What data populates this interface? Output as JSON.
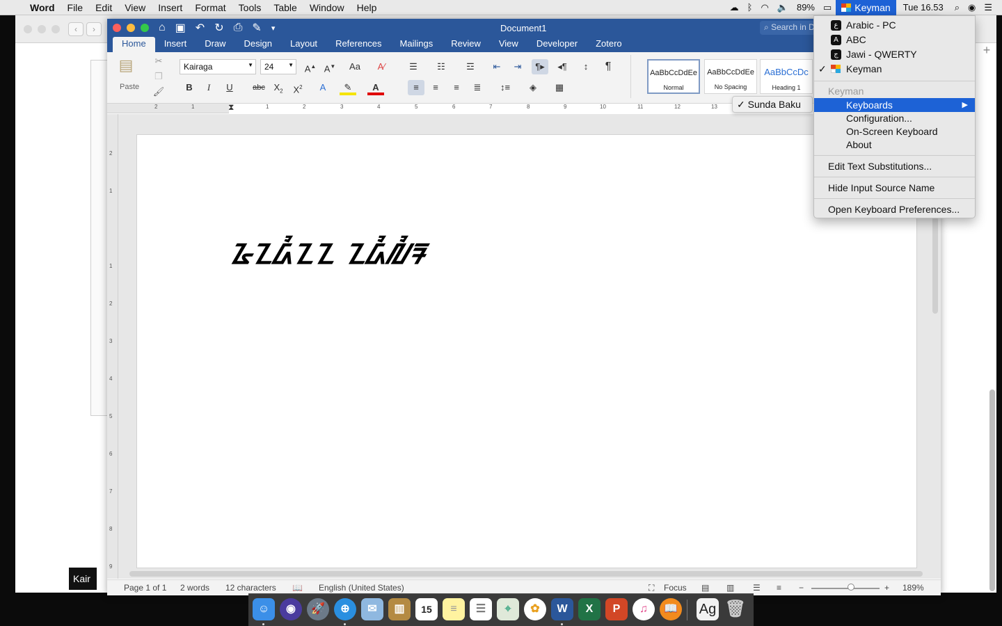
{
  "menubar": {
    "app_name": "Word",
    "menus": [
      "File",
      "Edit",
      "View",
      "Insert",
      "Format",
      "Tools",
      "Table",
      "Window",
      "Help"
    ],
    "battery": "89%",
    "input_source": "Keyman",
    "clock": "Tue 16.53"
  },
  "word": {
    "doc_title": "Document1",
    "search_placeholder": "Search in Document",
    "tabs": [
      "Home",
      "Insert",
      "Draw",
      "Design",
      "Layout",
      "References",
      "Mailings",
      "Review",
      "View",
      "Developer",
      "Zotero"
    ],
    "font_name": "Kairaga",
    "font_size": "24",
    "paste_label": "Paste",
    "styles": [
      {
        "preview": "AaBbCcDdEe",
        "name": "Normal"
      },
      {
        "preview": "AaBbCcDdEe",
        "name": "No Spacing"
      },
      {
        "preview": "AaBbCcDc",
        "name": "Heading 1"
      }
    ],
    "ruler_numbers": [
      "2",
      "1",
      "1",
      "2",
      "3",
      "4",
      "5",
      "6",
      "7",
      "8",
      "9",
      "10",
      "11",
      "12",
      "13"
    ],
    "vruler_numbers": [
      "2",
      "1",
      "1",
      "2",
      "3",
      "4",
      "5",
      "6",
      "7",
      "8",
      "9"
    ],
    "document_text": "ᮅᮔᮓᮤᮔᮔ ᮔᮓᮤᮜᮤᮛ",
    "status": {
      "page": "Page 1 of 1",
      "words": "2 words",
      "chars": "12 characters",
      "language": "English (United States)",
      "focus": "Focus",
      "zoom": "189%"
    }
  },
  "sunda_popup": {
    "check": "✓",
    "label": "Sunda Baku"
  },
  "input_menu": {
    "sources": [
      {
        "label": "Arabic - PC",
        "icon": "ع",
        "checked": false
      },
      {
        "label": "ABC",
        "icon": "A",
        "checked": false
      },
      {
        "label": "Jawi - QWERTY",
        "icon": "ج",
        "checked": false
      },
      {
        "label": "Keyman",
        "icon": "keyman-logo",
        "checked": true
      }
    ],
    "section_header": "Keyman",
    "keyman_items": [
      "Keyboards",
      "Configuration...",
      "On-Screen Keyboard",
      "About"
    ],
    "submenu_arrow": "▶",
    "edit_substitutions": "Edit Text Substitutions...",
    "hide_name": "Hide Input Source Name",
    "open_prefs": "Open Keyboard Preferences..."
  },
  "bg_window": {
    "dark_label": "Kair"
  },
  "dock": {
    "apps": [
      "Finder",
      "Siri",
      "Launchpad",
      "Safari",
      "Mail",
      "Notes",
      "Calendar",
      "Stickies",
      "Reminders",
      "Maps",
      "Photos",
      "Word",
      "Excel",
      "PowerPoint",
      "iTunes",
      "Books",
      "Font Book",
      "Trash"
    ],
    "calendar_day": "15",
    "fontbook_glyph": "Ag"
  },
  "colors": {
    "word_blue": "#2b579a",
    "menu_highlight": "#1d62d6",
    "dock": "#3a3a3a"
  }
}
